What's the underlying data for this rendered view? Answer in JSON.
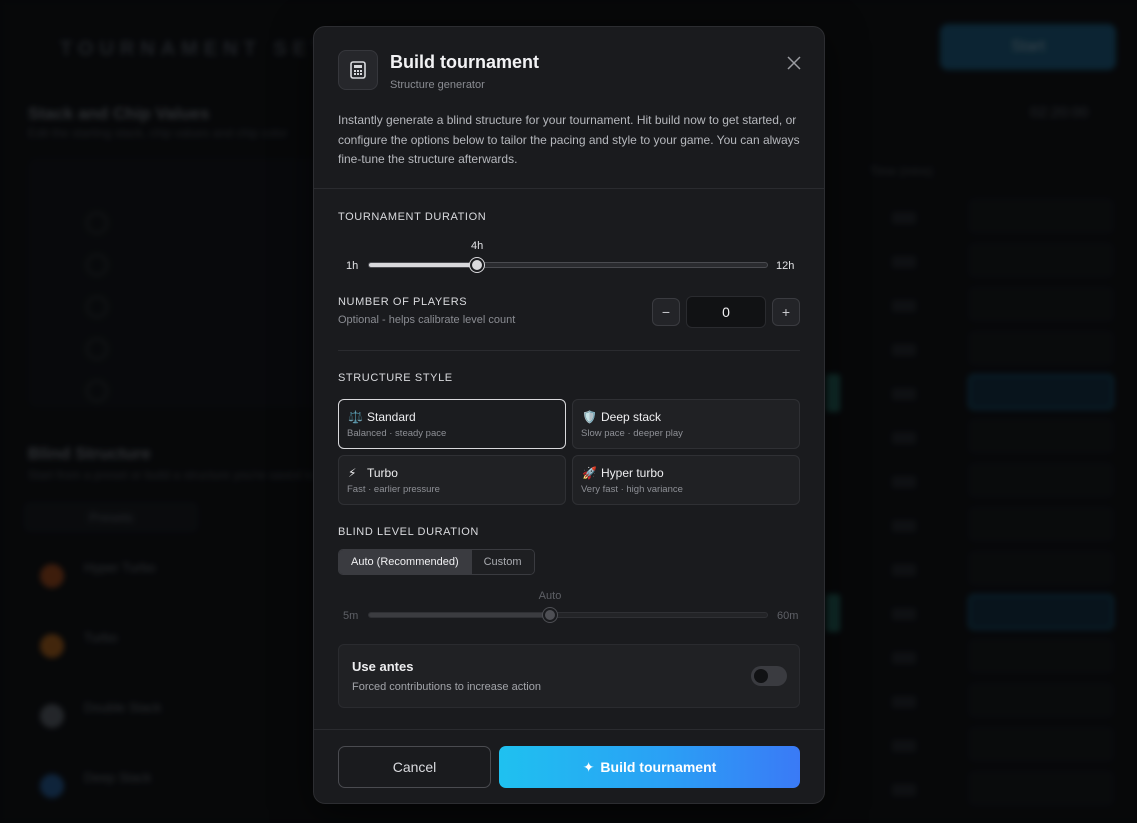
{
  "background": {
    "title": "TOURNAMENT SETTINGS",
    "start_label": "Start",
    "section1_title": "Stack and Chip Values",
    "section1_sub": "Edit the starting stack, chip values and chip color",
    "section2_title": "Blind Structure",
    "section2_sub": "Start from a preset or build a structure you're saved to",
    "presets_tab": "Presets",
    "presets": [
      {
        "name": "Hyper Turbo",
        "color": "#c2571e"
      },
      {
        "name": "Turbo",
        "color": "#d4761c"
      },
      {
        "name": "Double Stack",
        "color": "#6f7680"
      },
      {
        "name": "Deep Stack",
        "color": "#2c6fb8"
      }
    ],
    "clock": "02:20:00",
    "time_header": "Time (mins)"
  },
  "modal": {
    "title": "Build tournament",
    "subtitle": "Structure generator",
    "description": "Instantly generate a blind structure for your tournament. Hit build now to get started, or configure the options below to tailor the pacing and style to your game. You can always fine-tune the structure afterwards.",
    "icon": "calculator-icon",
    "duration": {
      "label": "TOURNAMENT DURATION",
      "min_label": "1h",
      "max_label": "12h",
      "value_label": "4h",
      "min": 1,
      "max": 12,
      "value": 4
    },
    "players": {
      "label": "NUMBER OF PLAYERS",
      "sublabel": "Optional - helps calibrate level count",
      "value": "0",
      "minus": "−",
      "plus": "+"
    },
    "style": {
      "label": "STRUCTURE STYLE",
      "options": [
        {
          "icon": "⚖️",
          "icon_name": "scale-icon",
          "name": "Standard",
          "desc": "Balanced · steady pace",
          "selected": true
        },
        {
          "icon": "🛡️",
          "icon_name": "shield-icon",
          "name": "Deep stack",
          "desc": "Slow pace · deeper play",
          "selected": false
        },
        {
          "icon": "⚡",
          "icon_name": "lightning-icon",
          "name": "Turbo",
          "desc": "Fast · earlier pressure",
          "selected": false
        },
        {
          "icon": "🚀",
          "icon_name": "rocket-icon",
          "name": "Hyper turbo",
          "desc": "Very fast · high variance",
          "selected": false
        }
      ]
    },
    "blind_duration": {
      "label": "BLIND LEVEL DURATION",
      "auto_label": "Auto (Recommended)",
      "custom_label": "Custom",
      "slider_value_label": "Auto",
      "min_label": "5m",
      "max_label": "60m",
      "fraction": 0.455
    },
    "antes": {
      "title": "Use antes",
      "desc": "Forced contributions to increase action",
      "enabled": false
    },
    "footer": {
      "cancel_label": "Cancel",
      "build_label": "Build tournament",
      "build_icon": "✦"
    }
  }
}
